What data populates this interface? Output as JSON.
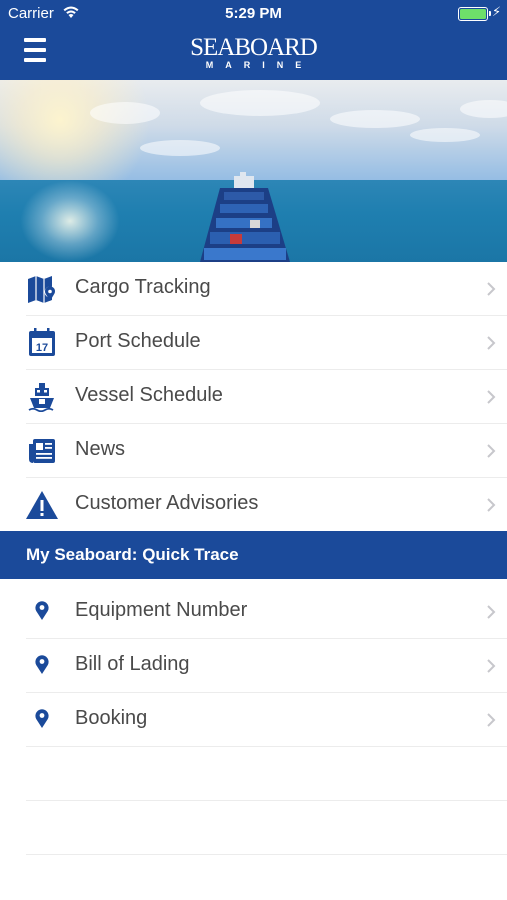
{
  "status_bar": {
    "carrier": "Carrier",
    "time": "5:29 PM"
  },
  "header": {
    "logo_main": "SEABOARD",
    "logo_sub": "MARINE",
    "menu_icon": "hamburger-icon"
  },
  "hero": {
    "image": "container ship at sea"
  },
  "menu": {
    "items": [
      {
        "label": "Cargo Tracking",
        "icon": "map-pin-icon"
      },
      {
        "label": "Port Schedule",
        "icon": "calendar-icon",
        "icon_text": "17"
      },
      {
        "label": "Vessel Schedule",
        "icon": "ship-icon"
      },
      {
        "label": "News",
        "icon": "newspaper-icon"
      },
      {
        "label": "Customer Advisories",
        "icon": "warning-icon"
      }
    ]
  },
  "quick_trace": {
    "title": "My Seaboard: Quick Trace",
    "items": [
      {
        "label": "Equipment Number",
        "icon": "location-pin-icon"
      },
      {
        "label": "Bill of Lading",
        "icon": "location-pin-icon"
      },
      {
        "label": "Booking",
        "icon": "location-pin-icon"
      }
    ]
  },
  "colors": {
    "brand_blue": "#1b4a9a",
    "text_gray": "#4a4a4a",
    "chevron": "#c7c7cc",
    "battery_green": "#6ee06a"
  }
}
